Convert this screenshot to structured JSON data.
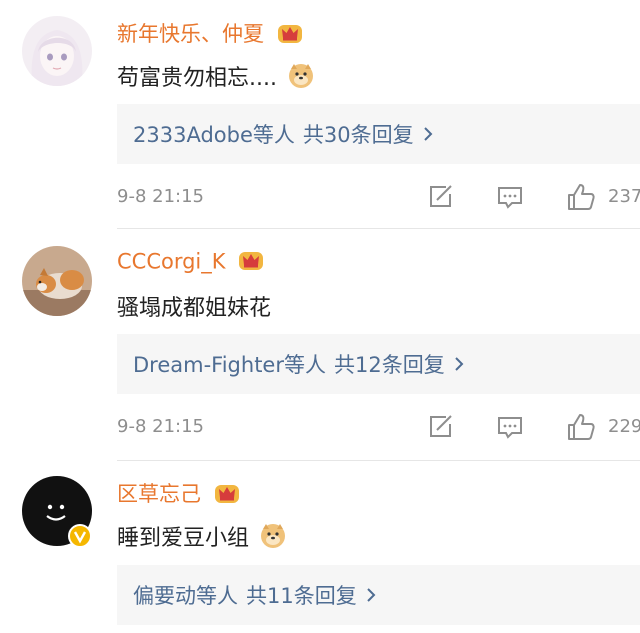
{
  "comments": [
    {
      "username": "新年快乐、仲夏",
      "text": "苟富贵勿相忘....",
      "reply_users": "2333Adobe等人",
      "reply_count": "共30条回复",
      "time": "9-8 21:15",
      "likes": "237"
    },
    {
      "username": "CCCorgi_K",
      "text": "骚塌成都姐妹花",
      "reply_users": "Dream-Fighter等人",
      "reply_count": "共12条回复",
      "time": "9-8 21:15",
      "likes": "229"
    },
    {
      "username": "区草忘己",
      "text": "睡到爱豆小组",
      "reply_users": "偏要动等人",
      "reply_count": "共11条回复"
    }
  ],
  "icons": {
    "crown": "crown-badge-icon",
    "emoji": "doge-emoji-icon",
    "repost": "repost-icon",
    "comment": "comment-icon",
    "like": "like-icon",
    "chevron": "chevron-right-icon",
    "verified": "verified-badge-icon"
  },
  "colors": {
    "username": "#e8772e",
    "reply_link": "#4e6c92",
    "meta": "#8e8e8e",
    "reply_bg": "#f6f6f6",
    "verified": "#f5b700"
  }
}
